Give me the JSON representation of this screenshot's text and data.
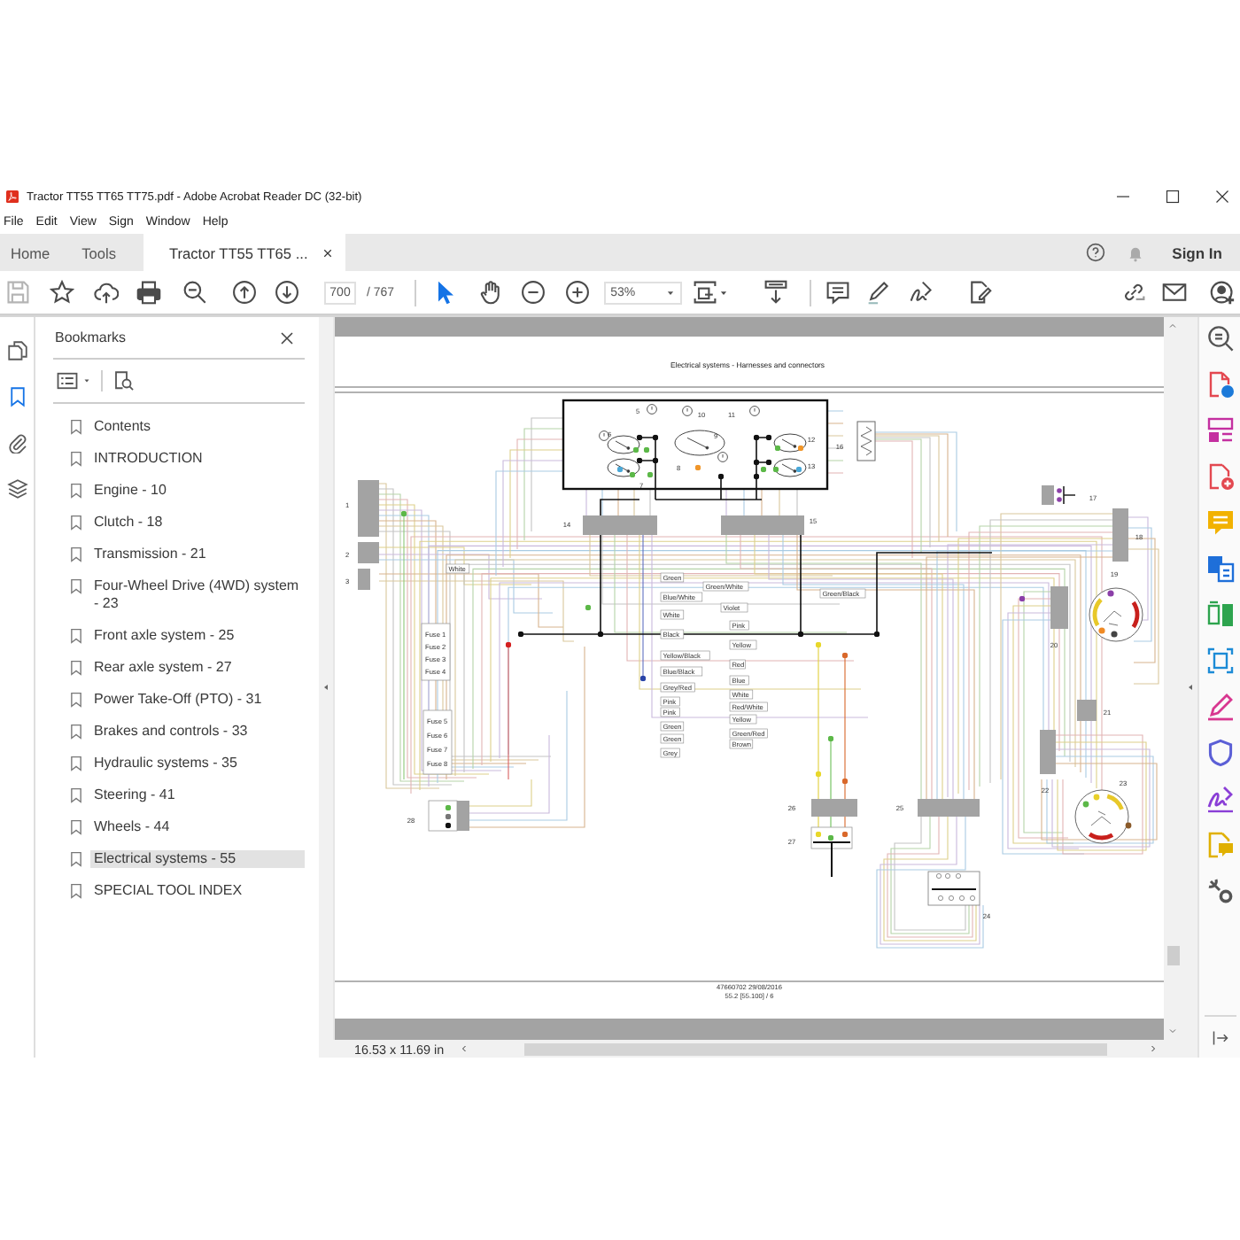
{
  "window": {
    "title": "Tractor TT55 TT65 TT75.pdf - Adobe Acrobat Reader DC (32-bit)"
  },
  "menu": [
    "File",
    "Edit",
    "View",
    "Sign",
    "Window",
    "Help"
  ],
  "tabs": [
    {
      "label": "Home",
      "selected": false,
      "closable": false
    },
    {
      "label": "Tools",
      "selected": false,
      "closable": false
    },
    {
      "label": "Tractor TT55 TT65 ...",
      "selected": true,
      "closable": true
    }
  ],
  "account": {
    "sign_in": "Sign In"
  },
  "toolbar": {
    "save_disabled": true,
    "page_number": "700",
    "page_count": "/ 767",
    "zoom": "53%"
  },
  "nav_rail": [
    {
      "kind": "pages",
      "selected": false
    },
    {
      "kind": "bookmarks",
      "selected": true
    },
    {
      "kind": "attachments",
      "selected": false
    },
    {
      "kind": "layers",
      "selected": false
    }
  ],
  "bookmarks": {
    "title": "Bookmarks",
    "items": [
      {
        "label": "Contents",
        "selected": false
      },
      {
        "label": "INTRODUCTION",
        "selected": false
      },
      {
        "label": "Engine - 10",
        "selected": false
      },
      {
        "label": "Clutch - 18",
        "selected": false
      },
      {
        "label": "Transmission - 21",
        "selected": false
      },
      {
        "label": "Four-Wheel Drive (4WD) system - 23",
        "selected": false
      },
      {
        "label": "Front axle system - 25",
        "selected": false
      },
      {
        "label": "Rear axle system - 27",
        "selected": false
      },
      {
        "label": "Power Take-Off (PTO) - 31",
        "selected": false
      },
      {
        "label": "Brakes and controls - 33",
        "selected": false
      },
      {
        "label": "Hydraulic systems - 35",
        "selected": false
      },
      {
        "label": "Steering - 41",
        "selected": false
      },
      {
        "label": "Wheels - 44",
        "selected": false
      },
      {
        "label": "Electrical systems - 55",
        "selected": true
      },
      {
        "label": "SPECIAL TOOL INDEX",
        "selected": false
      }
    ]
  },
  "document": {
    "title": "Electrical systems - Harnesses and connectors",
    "callouts": [
      "5",
      "10",
      "11",
      "6",
      "9",
      "8",
      "7",
      "12",
      "13",
      "16",
      "1",
      "2",
      "3",
      "14",
      "15",
      "17",
      "18",
      "19",
      "20",
      "21",
      "22",
      "23",
      "24",
      "25",
      "26",
      "27",
      "28"
    ],
    "fuses": [
      "Fuse 1",
      "Fuse 2",
      "Fuse 3",
      "Fuse 4",
      "Fuse 5",
      "Fuse 6",
      "Fuse 7",
      "Fuse 8"
    ],
    "wire_labels": [
      "White",
      "Green",
      "Green/White",
      "Green/Black",
      "Blue/White",
      "Violet",
      "White",
      "Pink",
      "Black",
      "Yellow",
      "Yellow/Black",
      "Red",
      "Blue/Black",
      "Blue",
      "Grey/Red",
      "White",
      "Pink",
      "Red/White",
      "Pink",
      "Yellow",
      "Green",
      "Green/Red",
      "Green",
      "Brown",
      "Grey"
    ],
    "footer": [
      "47660702 29/08/2016",
      "55.2 [55.100] / 6"
    ]
  },
  "status_bar": {
    "page_size": "16.53 x 11.69 in"
  }
}
